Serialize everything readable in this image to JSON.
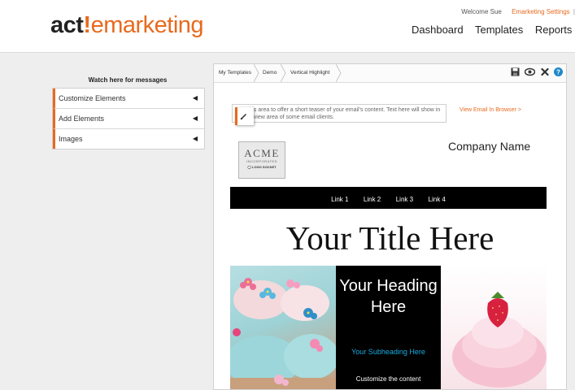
{
  "header": {
    "logo_act": "act",
    "logo_bang": "!",
    "logo_rest": "emarketing",
    "welcome": "Welcome Sue",
    "settings": "Emarketing Settings",
    "settings_sep": "|",
    "nav": [
      "Dashboard",
      "Templates",
      "Reports"
    ]
  },
  "left_panel": {
    "message_label": "Watch here for messages",
    "items": [
      "Customize Elements",
      "Add Elements",
      "Images"
    ],
    "arrow": "◀"
  },
  "editor": {
    "breadcrumbs": [
      "My Templates",
      "Demo",
      "Vertical Highlight"
    ],
    "toolbar_icons": [
      "save-icon",
      "preview-eye-icon",
      "close-icon",
      "help-icon"
    ],
    "help_glyph": "?",
    "preheader_text": "Use this area to offer a short teaser of your email's content. Text here will show in the preview area of some email clients.",
    "view_in_browser": "View Email In Browser >",
    "logo_name": "ACME",
    "logo_sub": "INCORPORATED",
    "logo_socket": "◯ LOGO SOCKET",
    "company_name": "Company Name",
    "links": [
      "Link 1",
      "Link 2",
      "Link 3",
      "Link 4"
    ],
    "title": "Your Title Here",
    "hero": {
      "heading": "Your Heading Here",
      "subheading": "Your Subheading Here",
      "body": "Customize the content"
    }
  },
  "colors": {
    "accent": "#e86a1e",
    "link_bar": "#000000",
    "subheading": "#18aee0",
    "help_icon": "#1e88c8"
  }
}
